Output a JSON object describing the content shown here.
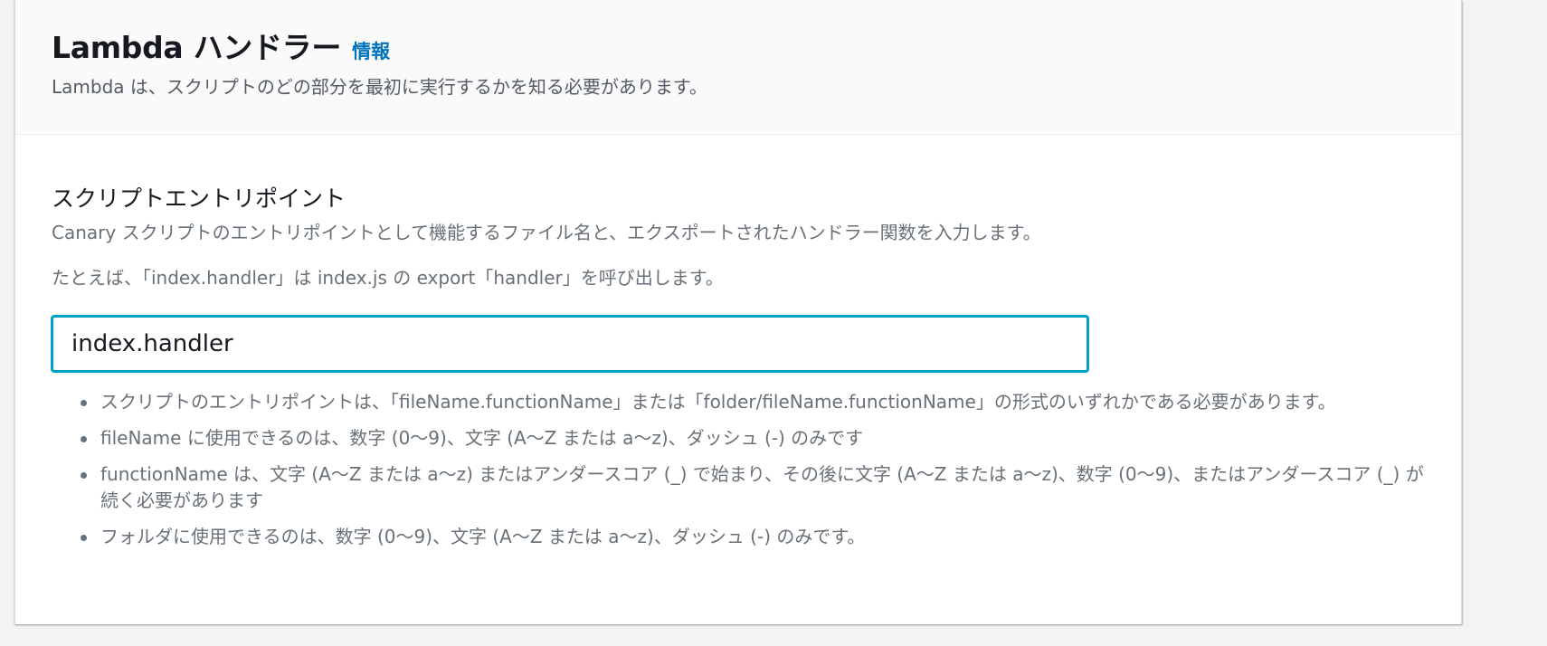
{
  "header": {
    "title": "Lambda ハンドラー",
    "info_link": "情報",
    "description": "Lambda は、スクリプトのどの部分を最初に実行するかを知る必要があります。"
  },
  "field": {
    "label": "スクリプトエントリポイント",
    "description": "Canary スクリプトのエントリポイントとして機能するファイル名と、エクスポートされたハンドラー関数を入力します。",
    "example": "たとえば、「index.handler」は index.js の export「handler」を呼び出します。",
    "value": "index.handler",
    "constraints": [
      "スクリプトのエントリポイントは、「fileName.functionName」または「folder/fileName.functionName」の形式のいずれかである必要があります。",
      "fileName に使用できるのは、数字 (0〜9)、文字 (A〜Z または a〜z)、ダッシュ (-) のみです",
      "functionName は、文字 (A〜Z または a〜z) またはアンダースコア (_) で始まり、その後に文字 (A〜Z または a〜z)、数字 (0〜9)、またはアンダースコア (_) が続く必要があります",
      "フォルダに使用できるのは、数字 (0〜9)、文字 (A〜Z または a〜z)、ダッシュ (-) のみです。"
    ]
  },
  "colors": {
    "accent": "#0073bb",
    "input_focus": "#00a1c9",
    "header_bg": "#fafafa",
    "page_bg": "#f2f3f3"
  }
}
